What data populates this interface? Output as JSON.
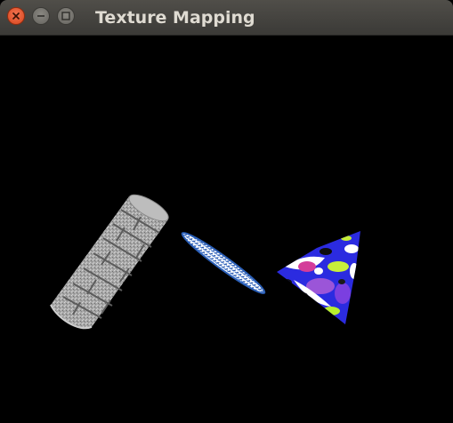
{
  "window": {
    "title": "Texture Mapping",
    "controls": {
      "close": "close-icon",
      "minimize": "minimize-icon",
      "maximize": "maximize-icon"
    }
  },
  "scene": {
    "background": "#000000",
    "objects": [
      {
        "kind": "cylinder",
        "texture": "stone-brick",
        "color": "#a9a9a9"
      },
      {
        "kind": "disk",
        "texture": "blue-speckle",
        "color": "#3f6fb5"
      },
      {
        "kind": "cone",
        "texture": "floral-pattern",
        "color": "#2f2fe0"
      }
    ]
  },
  "colors": {
    "titlebar": "#3c3b37",
    "title_text": "#dfdbd2",
    "close": "#e95420",
    "control": "#7a7873"
  }
}
